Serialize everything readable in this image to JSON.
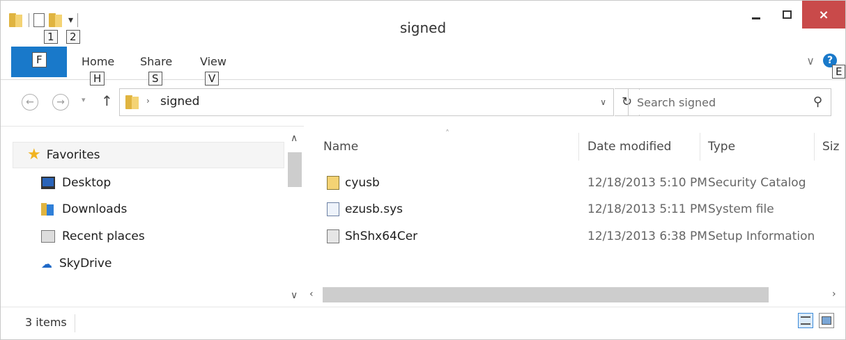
{
  "window": {
    "title": "signed",
    "minimize_icon": "minimize-icon",
    "maximize_icon": "maximize-icon",
    "close_glyph": "×",
    "accent": "#1979ca",
    "close_color": "#c94a4a"
  },
  "quick_access": {
    "dropdown_glyph": "▾",
    "keytips": [
      "1",
      "2"
    ]
  },
  "ribbon": {
    "file_keytip": "F",
    "tabs": [
      {
        "label": "Home",
        "keytip": "H"
      },
      {
        "label": "Share",
        "keytip": "S"
      },
      {
        "label": "View",
        "keytip": "V"
      }
    ],
    "expand_glyph": "∨",
    "help_glyph": "?",
    "help_keytip": "E"
  },
  "navigation": {
    "back_glyph": "←",
    "forward_glyph": "→",
    "recent_glyph": "▾",
    "up_glyph": "↑",
    "address": {
      "crumb_sep": "›",
      "path": "signed",
      "dropdown_glyph": "∨"
    },
    "refresh_glyph": "↻",
    "search": {
      "placeholder": "Search signed",
      "icon_glyph": "⚲"
    }
  },
  "nav_pane": {
    "favorites_label": "Favorites",
    "star_glyph": "★",
    "items": [
      {
        "label": "Desktop",
        "icon": "desktop-icon"
      },
      {
        "label": "Downloads",
        "icon": "downloads-folder-icon"
      },
      {
        "label": "Recent places",
        "icon": "recent-places-icon"
      },
      {
        "label": "SkyDrive",
        "icon": "skydrive-icon"
      }
    ],
    "scroll_up_glyph": "∧",
    "scroll_down_glyph": "∨"
  },
  "file_list": {
    "columns": [
      "Name",
      "Date modified",
      "Type",
      "Siz"
    ],
    "sort_glyph": "˄",
    "files": [
      {
        "name": "cyusb",
        "date": "12/18/2013 5:10 PM",
        "type": "Security Catalog",
        "icon": "security-catalog-icon"
      },
      {
        "name": "ezusb.sys",
        "date": "12/18/2013 5:11 PM",
        "type": "System file",
        "icon": "system-file-icon"
      },
      {
        "name": "ShShx64Cer",
        "date": "12/13/2013 6:38 PM",
        "type": "Setup Information",
        "icon": "setup-information-icon"
      }
    ],
    "scroll_left_glyph": "‹",
    "scroll_right_glyph": "›"
  },
  "status_bar": {
    "item_count": "3 items",
    "views": [
      "details-view-icon",
      "large-icons-view-icon"
    ]
  }
}
